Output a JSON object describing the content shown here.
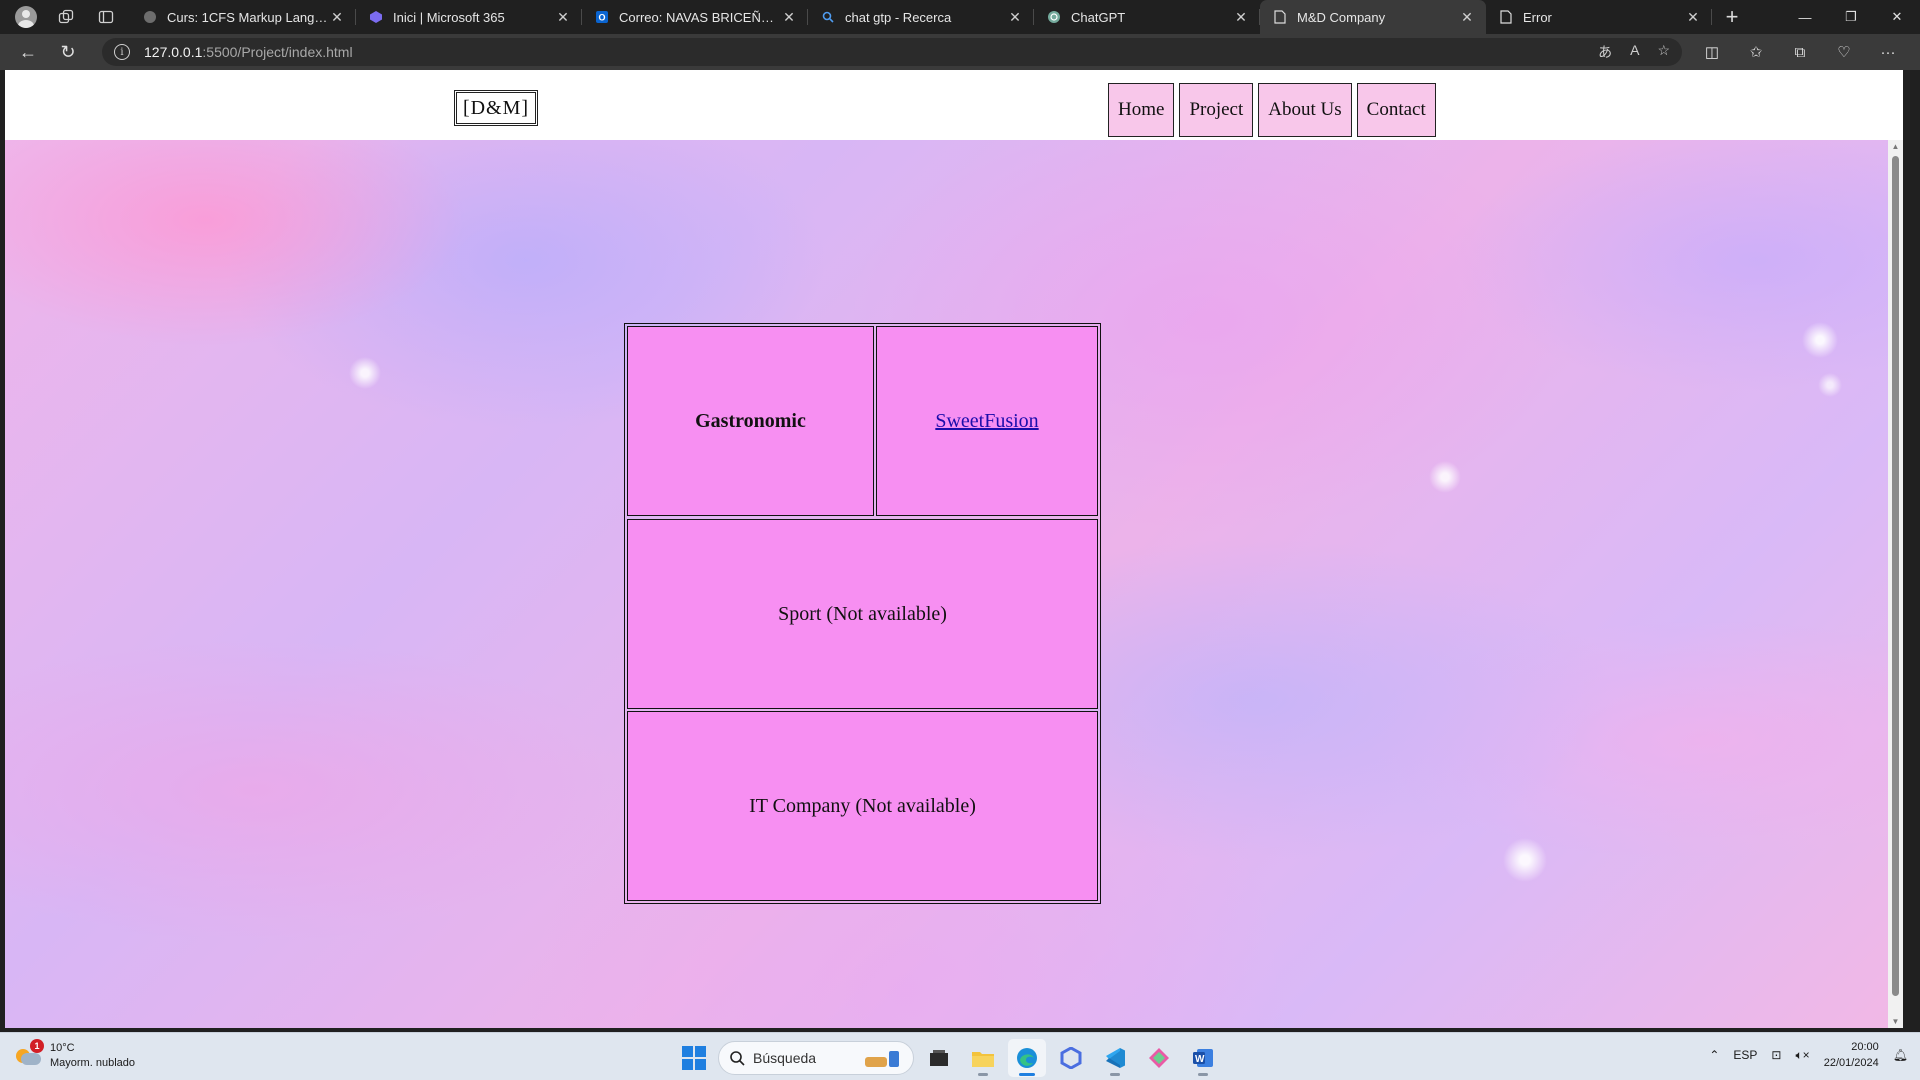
{
  "browser": {
    "tabs": [
      {
        "title": "Curs: 1CFS Markup Language",
        "favicon": "moodle-icon",
        "active": false
      },
      {
        "title": "Inici | Microsoft 365",
        "favicon": "m365-icon",
        "active": false
      },
      {
        "title": "Correo: NAVAS BRICEÑO, ADR",
        "favicon": "outlook-icon",
        "active": false
      },
      {
        "title": "chat gtp - Recerca",
        "favicon": "search-icon",
        "active": false
      },
      {
        "title": "ChatGPT",
        "favicon": "chatgpt-icon",
        "active": false
      },
      {
        "title": "M&D Company",
        "favicon": "page-icon",
        "active": true
      },
      {
        "title": "Error",
        "favicon": "page-icon",
        "active": false
      }
    ],
    "url_host": "127.0.0.1",
    "url_path": ":5500/Project/index.html"
  },
  "site": {
    "logo_text": "[D&M]",
    "nav": [
      "Home",
      "Project",
      "About Us",
      "Contact"
    ],
    "cells": {
      "gastronomic": "Gastronomic",
      "sweetfusion": "SweetFusion",
      "sport": "Sport (Not available)",
      "it_company": "IT Company (Not available)"
    },
    "colors": {
      "cell": "#f78ff2",
      "nav_bg": "#f8c7ea",
      "link": "#1a0dab"
    }
  },
  "taskbar": {
    "weather_temp": "10°C",
    "weather_desc": "Mayorm. nublado",
    "weather_badge": "1",
    "search_placeholder": "Búsqueda",
    "language": "ESP",
    "time": "20:00",
    "date": "22/01/2024"
  }
}
